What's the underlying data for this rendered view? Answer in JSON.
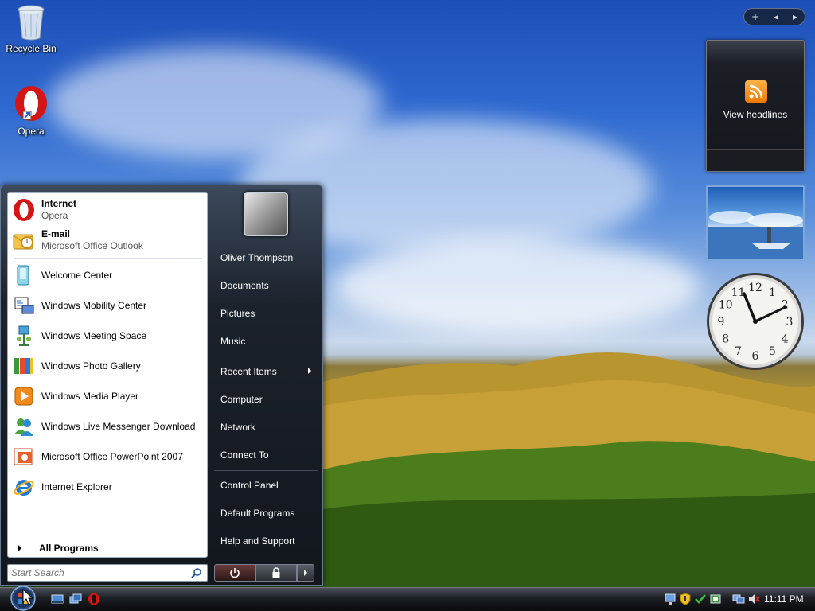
{
  "desktop": {
    "icons": [
      {
        "label": "Recycle Bin",
        "icon": "recycle-bin-icon"
      },
      {
        "label": "Opera",
        "icon": "opera-icon"
      }
    ]
  },
  "sidebar": {
    "controls": {
      "add": "+",
      "prev": "◂",
      "next": "▸"
    },
    "feed_gadget": {
      "label": "View headlines",
      "icon": "rss-icon"
    },
    "clock": {
      "numbers": [
        "12",
        "1",
        "2",
        "3",
        "4",
        "5",
        "6",
        "7",
        "8",
        "9",
        "10",
        "11"
      ]
    }
  },
  "start_menu": {
    "pinned": [
      {
        "title": "Internet",
        "subtitle": "Opera",
        "icon": "opera-icon"
      },
      {
        "title": "E-mail",
        "subtitle": "Microsoft Office Outlook",
        "icon": "outlook-icon"
      }
    ],
    "recent": [
      {
        "label": "Welcome Center",
        "icon": "welcome-center-icon"
      },
      {
        "label": "Windows Mobility Center",
        "icon": "mobility-center-icon"
      },
      {
        "label": "Windows Meeting Space",
        "icon": "meeting-space-icon"
      },
      {
        "label": "Windows Photo Gallery",
        "icon": "photo-gallery-icon"
      },
      {
        "label": "Windows Media Player",
        "icon": "media-player-icon"
      },
      {
        "label": "Windows Live Messenger Download",
        "icon": "messenger-icon"
      },
      {
        "label": "Microsoft Office PowerPoint 2007",
        "icon": "powerpoint-icon"
      },
      {
        "label": "Internet Explorer",
        "icon": "internet-explorer-icon"
      }
    ],
    "all_programs": "All Programs",
    "search_placeholder": "Start Search",
    "places": [
      {
        "label": "Oliver Thompson"
      },
      {
        "label": "Documents"
      },
      {
        "label": "Pictures"
      },
      {
        "label": "Music"
      },
      {
        "label": "Recent Items",
        "submenu": true
      },
      {
        "label": "Computer"
      },
      {
        "label": "Network"
      },
      {
        "label": "Connect To"
      },
      {
        "label": "Control Panel"
      },
      {
        "label": "Default Programs"
      },
      {
        "label": "Help and Support"
      }
    ],
    "power_icons": [
      "power-icon",
      "lock-icon",
      "arrow-icon"
    ]
  },
  "taskbar": {
    "quick_launch": [
      "show-desktop-icon",
      "switch-windows-icon",
      "opera-icon"
    ],
    "tray_icons": [
      "network-icon",
      "security-icon",
      "windows-defender-icon",
      "update-icon",
      "display-icon",
      "volume-muted-icon"
    ],
    "clock": "11:11 PM"
  },
  "colors": {
    "start_menu_dark": "#12161d",
    "taskbar": "#1b1e23",
    "accent_blue": "#2f6ad0"
  }
}
